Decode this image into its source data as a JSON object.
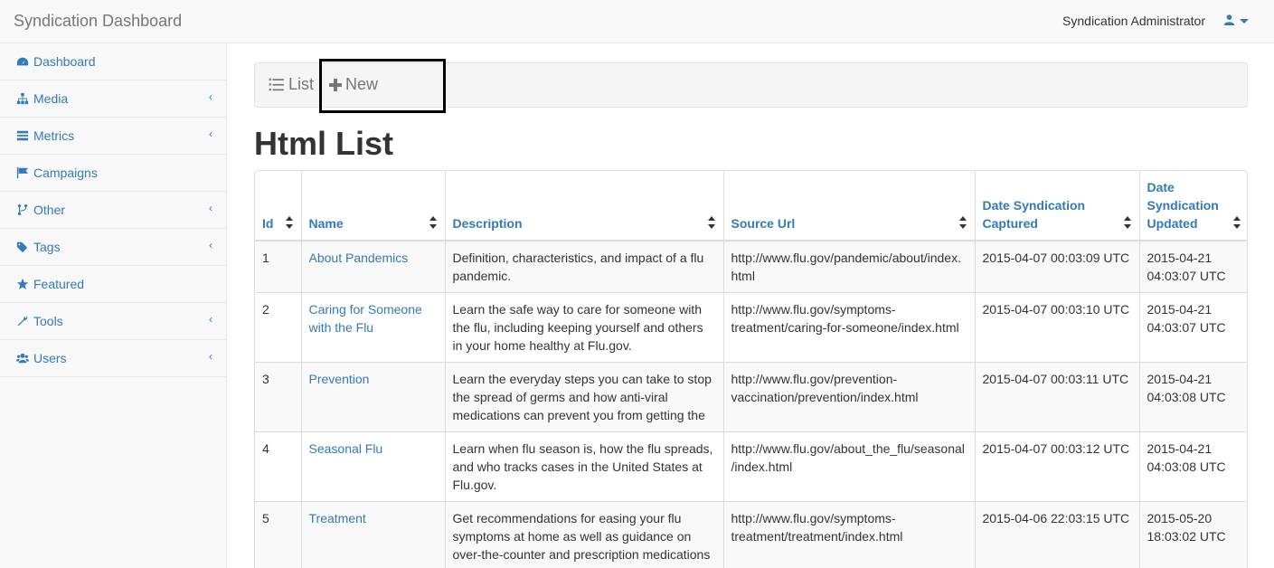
{
  "navbar": {
    "brand": "Syndication Dashboard",
    "user_name": "Syndication Administrator"
  },
  "sidebar": {
    "items": [
      {
        "label": "Dashboard",
        "icon": "dashboard-icon",
        "has_submenu": false
      },
      {
        "label": "Media",
        "icon": "sitemap-icon",
        "has_submenu": true
      },
      {
        "label": "Metrics",
        "icon": "list-icon",
        "has_submenu": true
      },
      {
        "label": "Campaigns",
        "icon": "flag-icon",
        "has_submenu": false
      },
      {
        "label": "Other",
        "icon": "code-fork-icon",
        "has_submenu": true
      },
      {
        "label": "Tags",
        "icon": "tags-icon",
        "has_submenu": true
      },
      {
        "label": "Featured",
        "icon": "star-icon",
        "has_submenu": false
      },
      {
        "label": "Tools",
        "icon": "wrench-icon",
        "has_submenu": true
      },
      {
        "label": "Users",
        "icon": "users-icon",
        "has_submenu": true
      }
    ]
  },
  "toolbar": {
    "list_label": "List",
    "new_label": "New"
  },
  "page_title": "Html List",
  "table": {
    "headers": [
      "Id",
      "Name",
      "Description",
      "Source Url",
      "Date Syndication Captured",
      "Date Syndication Updated"
    ],
    "rows": [
      {
        "id": "1",
        "name": "About Pandemics",
        "description": "Definition, characteristics, and impact of a flu pandemic.",
        "source_url": "http://www.flu.gov/pandemic/about/index.html",
        "captured": "2015-04-07 00:03:09 UTC",
        "updated": "2015-04-21 04:03:07 UTC"
      },
      {
        "id": "2",
        "name": "Caring for Someone with the Flu",
        "description": "Learn the safe way to care for someone with the flu, including keeping yourself and others in your home healthy at Flu.gov.",
        "source_url": "http://www.flu.gov/symptoms-treatment/caring-for-someone/index.html",
        "captured": "2015-04-07 00:03:10 UTC",
        "updated": "2015-04-21 04:03:07 UTC"
      },
      {
        "id": "3",
        "name": "Prevention",
        "description": "Learn the everyday steps you can take to stop the spread of germs and how anti-viral medications can prevent you from getting the",
        "source_url": "http://www.flu.gov/prevention-vaccination/prevention/index.html",
        "captured": "2015-04-07 00:03:11 UTC",
        "updated": "2015-04-21 04:03:08 UTC"
      },
      {
        "id": "4",
        "name": "Seasonal Flu",
        "description": "Learn when flu season is, how the flu spreads, and who tracks cases in the United States at Flu.gov.",
        "source_url": "http://www.flu.gov/about_the_flu/seasonal/index.html",
        "captured": "2015-04-07 00:03:12 UTC",
        "updated": "2015-04-21 04:03:08 UTC"
      },
      {
        "id": "5",
        "name": "Treatment",
        "description": "Get recommendations for easing your flu symptoms at home as well as guidance on over-the-counter and prescription medications",
        "source_url": "http://www.flu.gov/symptoms-treatment/treatment/index.html",
        "captured": "2015-04-06 22:03:15 UTC",
        "updated": "2015-05-20 18:03:02 UTC"
      }
    ]
  }
}
